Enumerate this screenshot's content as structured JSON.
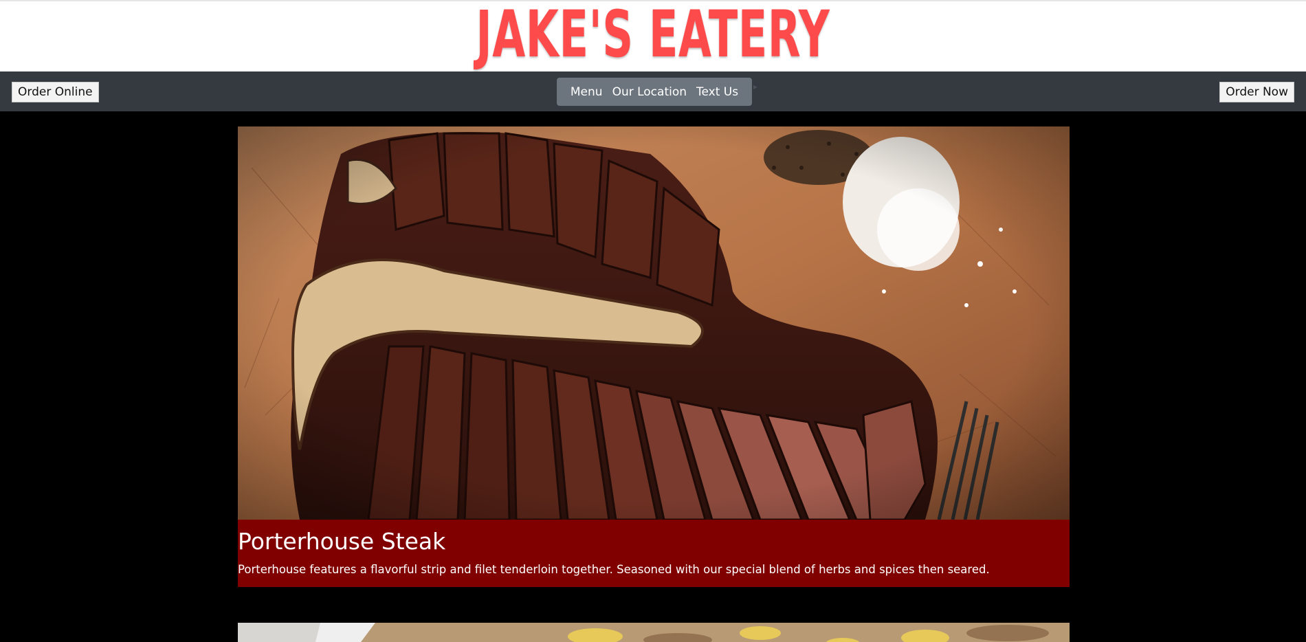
{
  "brand": {
    "name": "JAKE'S EATERY",
    "color": "#fd4a4a"
  },
  "navbar": {
    "order_online_label": "Order Online",
    "order_now_label": "Order Now",
    "links": [
      "Menu",
      "Our Location",
      "Text Us"
    ],
    "background": "#343a40",
    "pill_color": "#6c757d"
  },
  "menu_items": [
    {
      "title": "Porterhouse Steak",
      "description": "Porterhouse features a flavorful strip and filet tenderloin together. Seasoned with our special blend of herbs and spices then seared.",
      "image_subject": "sliced porterhouse steak on a wooden cutting board with cracked pepper, coarse salt and a fork",
      "caption_color": "#800000"
    },
    {
      "image_subject": "pasta dish (partially visible)"
    }
  ],
  "colors": {
    "page_background": "#000000",
    "caption_background": "#800000"
  }
}
